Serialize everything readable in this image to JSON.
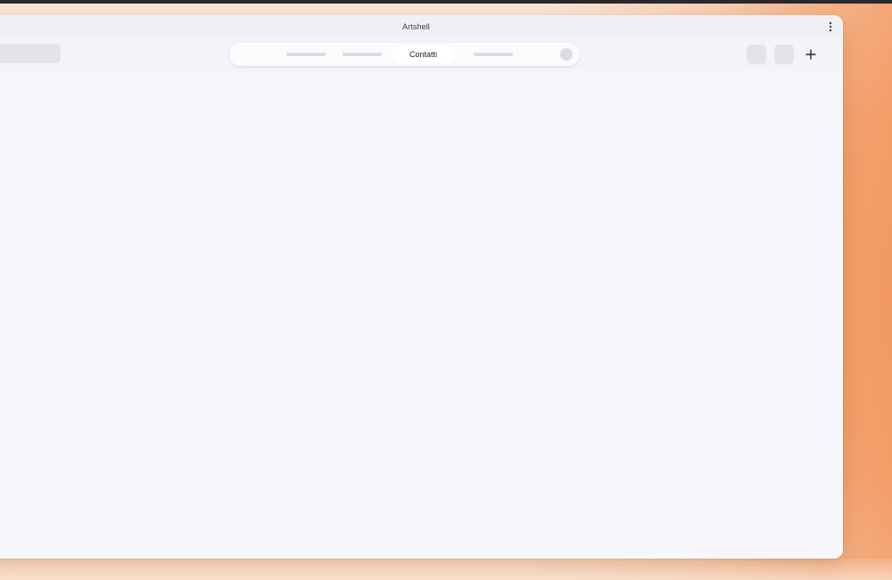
{
  "window": {
    "title": "Artshell"
  },
  "toolbar": {
    "tabs": [
      {
        "label": "",
        "state": "placeholder"
      },
      {
        "label": "",
        "state": "placeholder"
      },
      {
        "label": "Contatti",
        "state": "active"
      },
      {
        "label": "",
        "state": "placeholder"
      }
    ],
    "icons": {
      "menu": "kebab-menu-icon",
      "add": "plus-icon"
    }
  },
  "colors": {
    "accent_wallpaper": "#f4a26a",
    "window_bg": "#f5f6fa",
    "text": "#1e1e22"
  }
}
